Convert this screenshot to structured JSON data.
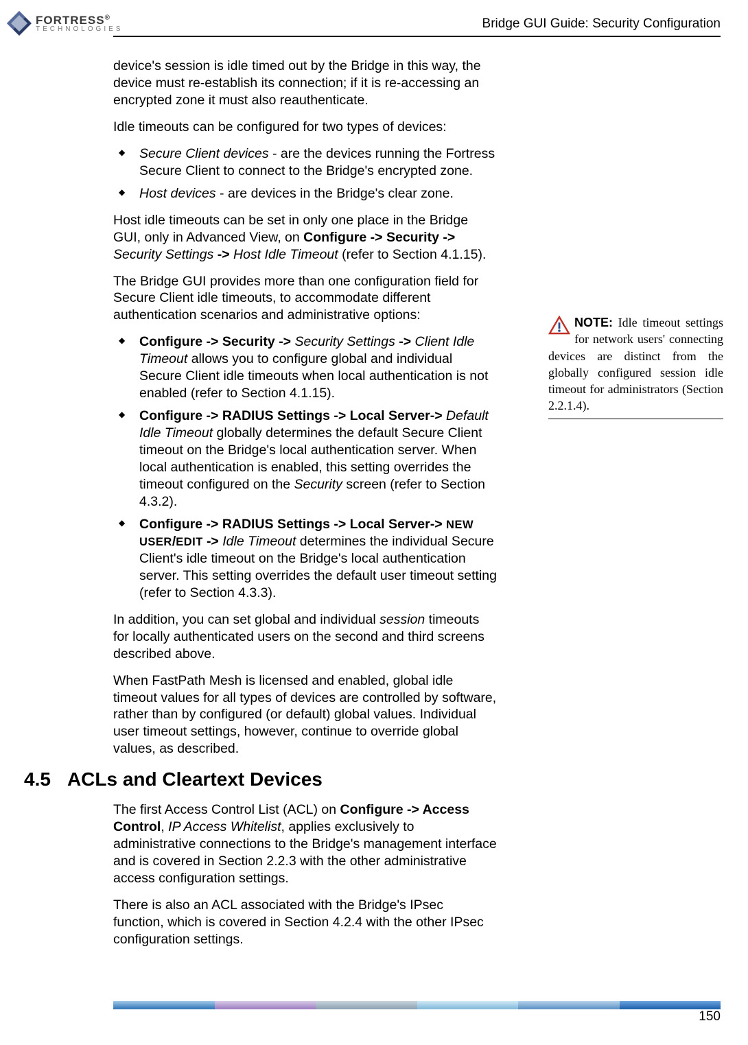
{
  "header": {
    "logo_main": "FORTRESS",
    "logo_reg": "®",
    "logo_sub": "TECHNOLOGIES",
    "right": "Bridge GUI Guide: Security Configuration"
  },
  "body": {
    "p1": "device's session is idle timed out by the Bridge in this way, the device must re-establish its connection; if it is re-accessing an encrypted zone it must also reauthenticate.",
    "p2": "Idle timeouts can be configured for two types of devices:",
    "li1a": "Secure Client devices",
    "li1b": " - are the devices running the Fortress Secure Client to connect to the Bridge's encrypted zone.",
    "li2a": "Host devices",
    "li2b": " - are devices in the Bridge's clear zone.",
    "p3a": "Host idle timeouts can be set in only one place in the Bridge GUI, only in Advanced View, on ",
    "p3b": "Configure ",
    "p3c": "-> ",
    "p3d": "Security ",
    "p3e": "-> ",
    "p3f": "Security Settings ",
    "p3g": "-> ",
    "p3h": "Host Idle Timeout",
    "p3i": " (refer to Section 4.1.15).",
    "p4": "The Bridge GUI provides more than one configuration field for Secure Client idle timeouts, to accommodate different authentication scenarios and administrative options:",
    "li3a": "Configure ",
    "li3b": "-> ",
    "li3c": "Security ",
    "li3d": "-> ",
    "li3e": "Security Settings ",
    "li3f": "-> ",
    "li3g": "Client Idle Timeout",
    "li3h": " allows you to configure global and individual Secure Client idle timeouts when local authentication is not enabled (refer to Section 4.1.15).",
    "li4a": "Configure ",
    "li4b": "-> ",
    "li4c": "RADIUS Settings ",
    "li4d": "-> ",
    "li4e": "Local Server",
    "li4f": "-> ",
    "li4g": "Default Idle Timeout",
    "li4h": " globally determines the default Secure Client timeout on the Bridge's local authentication server. When local authentication is enabled, this setting overrides the timeout configured on the ",
    "li4i": "Security",
    "li4j": " screen (refer to Section 4.3.2).",
    "li5a": "Configure ",
    "li5b": "-> ",
    "li5c": "RADIUS Settings ",
    "li5d": "-> ",
    "li5e": "Local Server",
    "li5f": "-> ",
    "li5g": "NEW USER",
    "li5h": "/",
    "li5i": "EDIT ",
    "li5j": "-> ",
    "li5k": "Idle Timeout",
    "li5l": " determines the individual Secure Client's idle timeout on the Bridge's local authentication server. This setting overrides the default user timeout setting (refer to Section 4.3.3).",
    "p5a": "In addition, you can set global and individual ",
    "p5b": "session",
    "p5c": " timeouts for locally authenticated users on the second and third screens described above.",
    "p6": "When FastPath Mesh is licensed and enabled, global idle timeout values for all types of devices are controlled by software, rather than by configured (or default) global values. Individual user timeout settings, however, continue to override global values, as described.",
    "sec_num": "4.5",
    "sec_title": "ACLs and Cleartext Devices",
    "p7a": "The first Access Control List (ACL) on ",
    "p7b": "Configure -> Access Control",
    "p7c": ", ",
    "p7d": "IP Access Whitelist",
    "p7e": ", applies exclusively to administrative connections to the Bridge's management interface and is covered in Section 2.2.3 with the other administrative access configuration settings.",
    "p8": "There is also an ACL associated with the Bridge's IPsec function, which is covered in Section 4.2.4 with the other IPsec configuration settings."
  },
  "note": {
    "label": "NOTE:",
    "text": " Idle timeout settings for network users' connecting devices are distinct from the globally configured session idle timeout for administrators (Section 2.2.1.4)."
  },
  "page_number": "150"
}
